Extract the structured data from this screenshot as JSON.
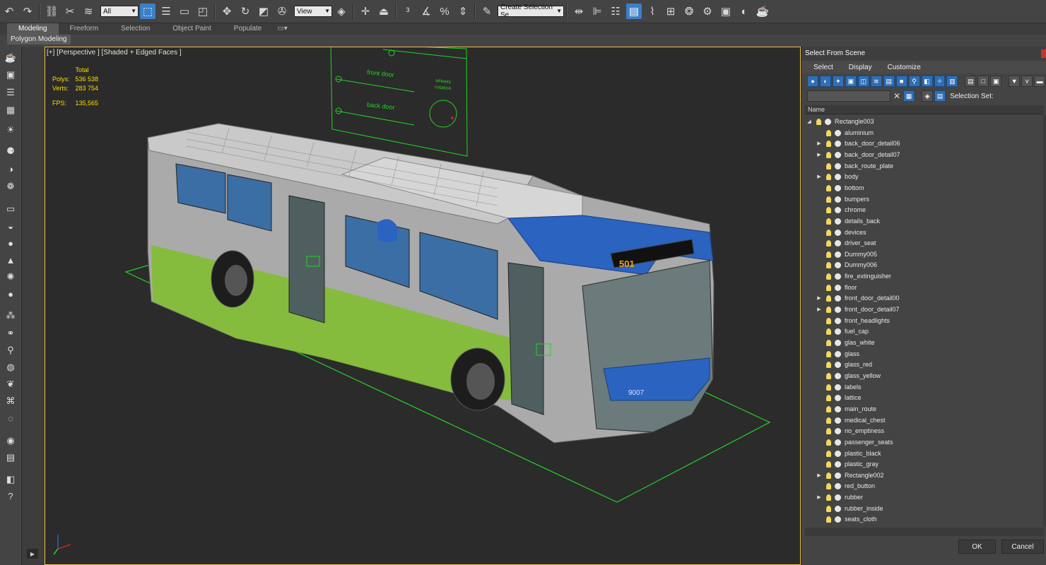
{
  "toolbar": {
    "selection_filter": "All",
    "ref_coord": "View",
    "named_selection": "Create Selection Se",
    "icons": [
      "undo-icon",
      "redo-icon",
      "link-icon",
      "unlink-icon",
      "bind-spacewarp-icon",
      "select-object-icon",
      "select-by-name-icon",
      "rect-region-icon",
      "window-crossing-icon",
      "move-icon",
      "rotate-icon",
      "scale-icon",
      "placement-icon",
      "pivot-icon",
      "snap-icon",
      "angle-snap-icon",
      "percent-snap-icon",
      "spinner-snap-icon",
      "edit-named-sel-icon",
      "mirror-icon",
      "align-icon",
      "scene-explorer-icon",
      "layer-explorer-icon",
      "curve-editor-icon",
      "schematic-icon",
      "material-editor-icon",
      "render-setup-icon",
      "render-frame-icon",
      "render-icon",
      "teapot-icon"
    ]
  },
  "ribbon": {
    "tabs": [
      "Modeling",
      "Freeform",
      "Selection",
      "Object Paint",
      "Populate"
    ],
    "sub_label": "Polygon Modeling"
  },
  "viewport": {
    "label": "[+] [Perspective ] [Shaded + Edged Faces ]",
    "stats": {
      "header": "Total",
      "polys_label": "Polys:",
      "polys": "536 538",
      "verts_label": "Verts:",
      "verts": "283 754",
      "fps_label": "FPS:",
      "fps": "135,565"
    },
    "panel_texts": {
      "front_door": "front door",
      "back_door": "back door",
      "wheels": "wheels",
      "rotation": "rotation"
    },
    "bus_texts": {
      "route": "501",
      "fleet": "9007"
    }
  },
  "dialog": {
    "title": "Select From Scene",
    "menu": [
      "Select",
      "Display",
      "Customize"
    ],
    "search_placeholder": "",
    "selection_sets_label": "Selection Set:",
    "column_header": "Name",
    "ok_label": "OK",
    "cancel_label": "Cancel",
    "root": "Rectangle003",
    "items": [
      {
        "name": "aluminium",
        "expandable": false
      },
      {
        "name": "back_door_detail06",
        "expandable": true
      },
      {
        "name": "back_door_detail07",
        "expandable": true
      },
      {
        "name": "back_route_plate",
        "expandable": false
      },
      {
        "name": "body",
        "expandable": true
      },
      {
        "name": "bottom",
        "expandable": false
      },
      {
        "name": "bumpers",
        "expandable": false
      },
      {
        "name": "chrome",
        "expandable": false
      },
      {
        "name": "details_back",
        "expandable": false
      },
      {
        "name": "devices",
        "expandable": false
      },
      {
        "name": "driver_seat",
        "expandable": false
      },
      {
        "name": "Dummy005",
        "expandable": false
      },
      {
        "name": "Dummy006",
        "expandable": false
      },
      {
        "name": "fire_extinguisher",
        "expandable": false
      },
      {
        "name": "floor",
        "expandable": false
      },
      {
        "name": "front_door_detail00",
        "expandable": true
      },
      {
        "name": "front_door_detail07",
        "expandable": true
      },
      {
        "name": "front_headlights",
        "expandable": false
      },
      {
        "name": "fuel_cap",
        "expandable": false
      },
      {
        "name": "glas_white",
        "expandable": false
      },
      {
        "name": "glass",
        "expandable": false
      },
      {
        "name": "glass_red",
        "expandable": false
      },
      {
        "name": "glass_yellow",
        "expandable": false
      },
      {
        "name": "labels",
        "expandable": false
      },
      {
        "name": "lattice",
        "expandable": false
      },
      {
        "name": "main_route",
        "expandable": false
      },
      {
        "name": "medical_chest",
        "expandable": false
      },
      {
        "name": "no_emptiness",
        "expandable": false
      },
      {
        "name": "passenger_seats",
        "expandable": false
      },
      {
        "name": "plastic_black",
        "expandable": false
      },
      {
        "name": "plastic_gray",
        "expandable": false
      },
      {
        "name": "Rectangle002",
        "expandable": true
      },
      {
        "name": "red_button",
        "expandable": false
      },
      {
        "name": "rubber",
        "expandable": true
      },
      {
        "name": "rubber_inside",
        "expandable": false
      },
      {
        "name": "seats_cloth",
        "expandable": false
      }
    ]
  },
  "colors": {
    "accent": "#3c7fc7",
    "wire_green": "#22d422",
    "bus_blue": "#2a63c0",
    "bus_green": "#7fbf2a",
    "stats_yellow": "#ffde00"
  }
}
